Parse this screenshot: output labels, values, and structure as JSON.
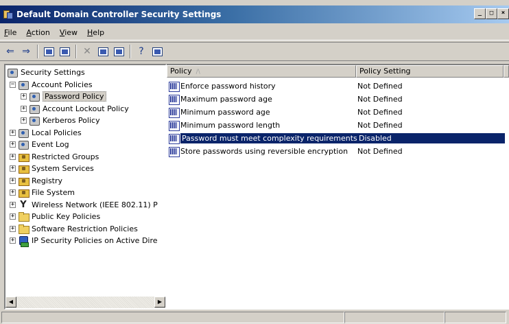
{
  "window": {
    "title": "Default Domain Controller Security Settings",
    "buttons": {
      "minimize": "_",
      "maximize": "□",
      "close": "×"
    }
  },
  "menu": {
    "items": [
      {
        "label": "File",
        "mnemonic": "F",
        "rest": "ile"
      },
      {
        "label": "Action",
        "mnemonic": "A",
        "rest": "ction"
      },
      {
        "label": "View",
        "mnemonic": "V",
        "rest": "iew"
      },
      {
        "label": "Help",
        "mnemonic": "H",
        "rest": "elp"
      }
    ]
  },
  "toolbar": {
    "back_icon": "back-arrow-icon",
    "forward_icon": "forward-arrow-icon",
    "up_icon": "up-level-icon",
    "show_tree_icon": "show-hide-tree-icon",
    "delete_icon": "delete-icon",
    "properties_icon": "properties-icon",
    "export_icon": "export-list-icon",
    "help_icon": "help-icon",
    "console_icon": "show-hide-console-icon",
    "back_glyph": "⇐",
    "forward_glyph": "⇒",
    "delete_glyph": "✕",
    "help_glyph": "?"
  },
  "tree": {
    "items": [
      {
        "label": "Security Settings"
      },
      {
        "label": "Account Policies"
      },
      {
        "label": "Password Policy"
      },
      {
        "label": "Account Lockout Policy"
      },
      {
        "label": "Kerberos Policy"
      },
      {
        "label": "Local Policies"
      },
      {
        "label": "Event Log"
      },
      {
        "label": "Restricted Groups"
      },
      {
        "label": "System Services"
      },
      {
        "label": "Registry"
      },
      {
        "label": "File System"
      },
      {
        "label": "Wireless Network (IEEE 802.11) P"
      },
      {
        "label": "Public Key Policies"
      },
      {
        "label": "Software Restriction Policies"
      },
      {
        "label": "IP Security Policies on Active Dire"
      }
    ],
    "expand_glyph": "+",
    "collapse_glyph": "−"
  },
  "list": {
    "columns": [
      {
        "label": "Policy",
        "sort_indicator": "/\\"
      },
      {
        "label": "Policy Setting"
      }
    ],
    "rows": [
      {
        "policy": "Enforce password history",
        "setting": "Not Defined"
      },
      {
        "policy": "Maximum password age",
        "setting": "Not Defined"
      },
      {
        "policy": "Minimum password age",
        "setting": "Not Defined"
      },
      {
        "policy": "Minimum password length",
        "setting": "Not Defined"
      },
      {
        "policy": "Password must meet complexity requirements",
        "setting": "Disabled"
      },
      {
        "policy": "Store passwords using reversible encryption",
        "setting": "Not Defined"
      }
    ],
    "selected_row": 4
  },
  "scrollbar": {
    "left_glyph": "◀",
    "right_glyph": "▶"
  },
  "colors": {
    "selection": "#0a246a",
    "window_bg": "#d4d0c8"
  }
}
